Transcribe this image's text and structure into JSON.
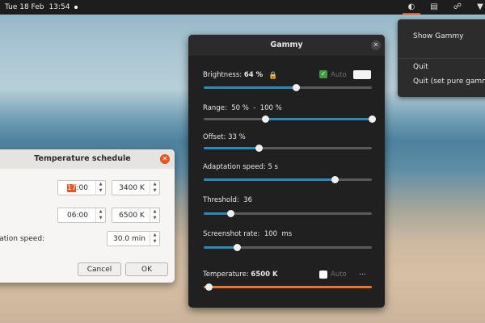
{
  "topbar": {
    "date": "Tue 18 Feb",
    "time": "13:54",
    "tray_icons": [
      "gammy-icon",
      "accessibility-icon",
      "network-icon",
      "power-icon"
    ]
  },
  "menu": {
    "show": "Show Gammy",
    "quit": "Quit",
    "quit_pure": "Quit (set pure gamma)"
  },
  "gammy": {
    "title": "Gammy",
    "brightness_label": "Brightness:",
    "brightness_value": "64 %",
    "brightness_level": 0.55,
    "auto_label": "Auto",
    "range_label": "Range:",
    "range_min": "50 %",
    "range_sep": "-",
    "range_max": "100 %",
    "range_low_level": 0.37,
    "range_high_level": 1.0,
    "offset_label": "Offset:",
    "offset_value": "33 %",
    "offset_level": 0.33,
    "adapt_label": "Adaptation speed:",
    "adapt_value": "5 s",
    "adapt_level": 0.78,
    "threshold_label": "Threshold:",
    "threshold_value": "36",
    "threshold_level": 0.16,
    "rate_label": "Screenshot rate:",
    "rate_value": "100",
    "rate_unit": "ms",
    "rate_level": 0.2,
    "temp_label": "Temperature:",
    "temp_value": "6500 K",
    "temp_auto_label": "Auto",
    "temp_more": "...",
    "temp_level": 0.03
  },
  "schedule": {
    "title": "Temperature schedule",
    "row1_time_hl": "17",
    "row1_time_rest": ":00",
    "row1_temp": "3400 K",
    "row2_time": "06:00",
    "row2_temp": "6500 K",
    "speed_label": "ptation speed:",
    "speed_value": "30.0 min",
    "cancel_label": "Cancel",
    "ok_label": "OK"
  },
  "colors": {
    "accent": "#e95420",
    "slider_blue": "#2a8bb8",
    "slider_orange": "#e9742a",
    "auto_check": "#3e9e3e"
  }
}
